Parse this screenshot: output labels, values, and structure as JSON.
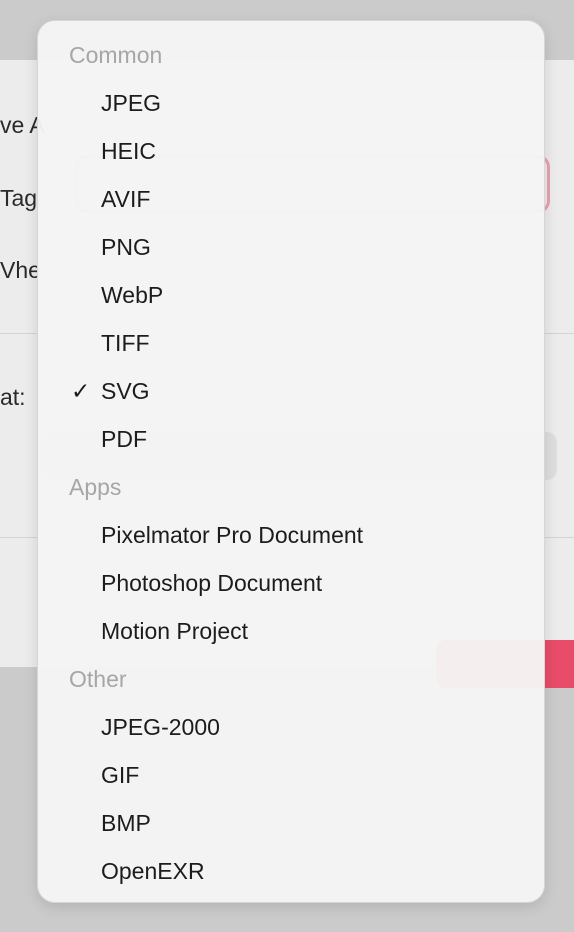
{
  "background_dialog": {
    "labels": [
      {
        "name": "save-as-label",
        "text": "ve A"
      },
      {
        "name": "tags-label",
        "text": "Tag"
      },
      {
        "name": "where-label",
        "text": "Vhe"
      },
      {
        "name": "format-label",
        "text": "at:"
      }
    ],
    "accent_color": "#e84c68"
  },
  "menu": {
    "selected_item": "SVG",
    "check_glyph": "✓",
    "sections": [
      {
        "header": "Common",
        "items": [
          "JPEG",
          "HEIC",
          "AVIF",
          "PNG",
          "WebP",
          "TIFF",
          "SVG",
          "PDF"
        ]
      },
      {
        "header": "Apps",
        "items": [
          "Pixelmator Pro Document",
          "Photoshop Document",
          "Motion Project"
        ]
      },
      {
        "header": "Other",
        "items": [
          "JPEG-2000",
          "GIF",
          "BMP",
          "OpenEXR"
        ]
      }
    ]
  }
}
